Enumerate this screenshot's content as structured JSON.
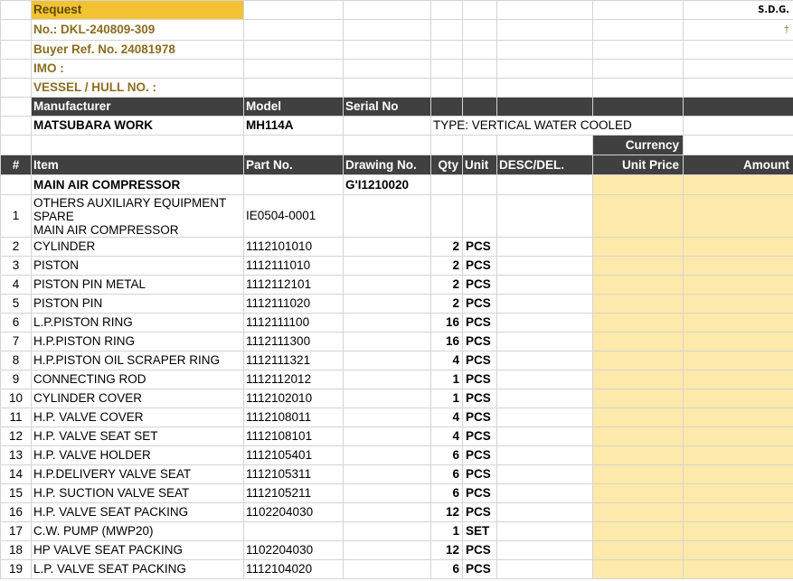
{
  "header": {
    "request": "Request",
    "no": "No.:  DKL-240809-309",
    "buyer_ref": "Buyer Ref. No. 24081978",
    "imo": "IMO :",
    "vessel": "VESSEL / HULL NO. :",
    "sdg": "S.D.G.",
    "cross": "†"
  },
  "equipment": {
    "manufacturer_label": "Manufacturer",
    "model_label": "Model",
    "serial_label": "Serial No",
    "manufacturer": "MATSUBARA WORK",
    "model": "MH114A",
    "type": "TYPE: VERTICAL WATER COOLED"
  },
  "currency_label": "Currency",
  "columns": {
    "num": "#",
    "item": "Item",
    "part_no": "Part No.",
    "drawing_no": "Drawing No.",
    "qty": "Qty",
    "unit": "Unit",
    "desc": "DESC/DEL.",
    "unit_price": "Unit Price",
    "amount": "Amount"
  },
  "group": {
    "title": "MAIN AIR COMPRESSOR",
    "drawing": "G'I1210020"
  },
  "first_item": {
    "num": "1",
    "line1": "OTHERS AUXILIARY EQUIPMENT",
    "line2": "SPARE",
    "line3": "MAIN AIR COMPRESSOR",
    "part_no": "IE0504-0001"
  },
  "rows": [
    {
      "num": "2",
      "item": "CYLINDER",
      "part": "1112101010",
      "qty": "2",
      "unit": "PCS"
    },
    {
      "num": "3",
      "item": "PISTON",
      "part": "1112111010",
      "qty": "2",
      "unit": "PCS"
    },
    {
      "num": "4",
      "item": "PISTON PIN METAL",
      "part": "1112112101",
      "qty": "2",
      "unit": "PCS"
    },
    {
      "num": "5",
      "item": "PISTON PIN",
      "part": "1112111020",
      "qty": "2",
      "unit": "PCS"
    },
    {
      "num": "6",
      "item": "L.P.PISTON RING",
      "part": "1112111100",
      "qty": "16",
      "unit": "PCS"
    },
    {
      "num": "7",
      "item": "H.P.PISTON RING",
      "part": "1112111300",
      "qty": "16",
      "unit": "PCS"
    },
    {
      "num": "8",
      "item": "H.P.PISTON OIL SCRAPER RING",
      "part": "1112111321",
      "qty": "4",
      "unit": "PCS"
    },
    {
      "num": "9",
      "item": "CONNECTING ROD",
      "part": "1112112012",
      "qty": "1",
      "unit": "PCS"
    },
    {
      "num": "10",
      "item": "CYLINDER COVER",
      "part": "1112102010",
      "qty": "1",
      "unit": "PCS"
    },
    {
      "num": "11",
      "item": "H.P. VALVE COVER",
      "part": "1112108011",
      "qty": "4",
      "unit": "PCS"
    },
    {
      "num": "12",
      "item": "H.P. VALVE SEAT SET",
      "part": "1112108101",
      "qty": "4",
      "unit": "PCS"
    },
    {
      "num": "13",
      "item": "H.P. VALVE HOLDER",
      "part": "1112105401",
      "qty": "6",
      "unit": "PCS"
    },
    {
      "num": "14",
      "item": "H.P.DELIVERY VALVE SEAT",
      "part": "1112105311",
      "qty": "6",
      "unit": "PCS"
    },
    {
      "num": "15",
      "item": "H.P. SUCTION VALVE SEAT",
      "part": "1112105211",
      "qty": "6",
      "unit": "PCS"
    },
    {
      "num": "16",
      "item": "H.P. VALVE SEAT PACKING",
      "part": "1102204030",
      "qty": "12",
      "unit": "PCS"
    },
    {
      "num": "17",
      "item": "C.W. PUMP (MWP20)",
      "part": "",
      "qty": "1",
      "unit": "SET"
    },
    {
      "num": "18",
      "item": "HP VALVE SEAT PACKING",
      "part": "1102204030",
      "qty": "12",
      "unit": "PCS"
    },
    {
      "num": "19",
      "item": "L.P. VALVE SEAT PACKING",
      "part": "1112104020",
      "qty": "6",
      "unit": "PCS"
    }
  ]
}
